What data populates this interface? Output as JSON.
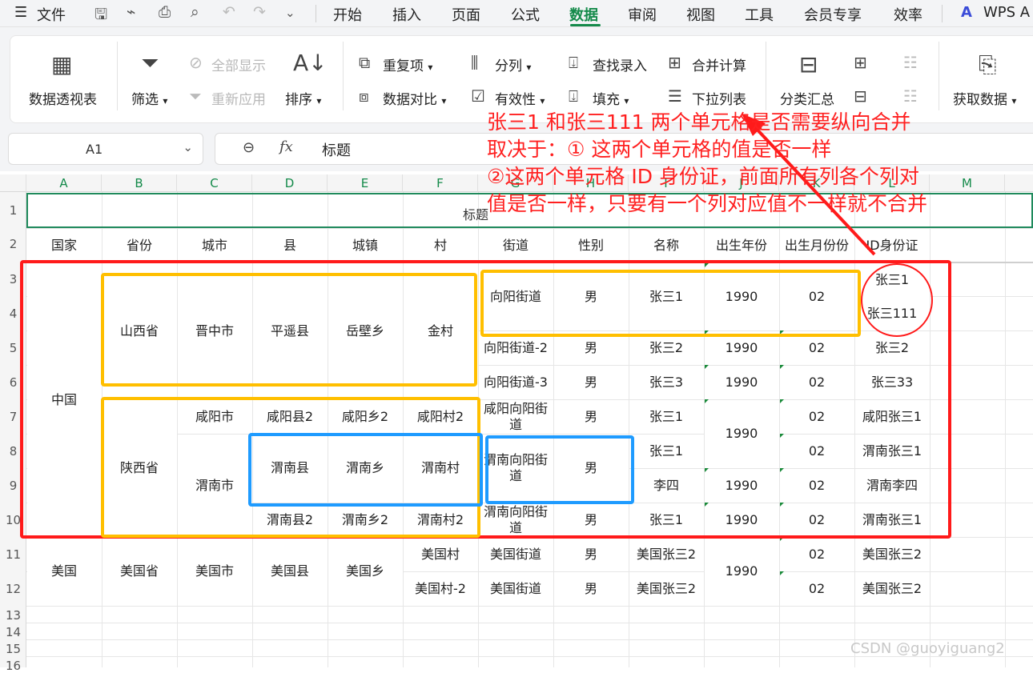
{
  "menubar": {
    "items": [
      "文件",
      "开始",
      "插入",
      "页面",
      "公式",
      "数据",
      "审阅",
      "视图",
      "工具",
      "会员专享",
      "效率"
    ],
    "active": "数据",
    "brand": "WPS A",
    "menu_icon": "hamburger-icon"
  },
  "ribbon": {
    "pivot": "数据透视表",
    "filter": "筛选",
    "show_all": "全部显示",
    "reapply": "重新应用",
    "sort": "排序",
    "duplicates": "重复项",
    "compare": "数据对比",
    "split": "分列",
    "validity": "有效性",
    "lookup_entry": "查找录入",
    "fill": "填充",
    "consolidate": "合并计算",
    "dropdown_list": "下拉列表",
    "subtotal": "分类汇总",
    "get_data": "获取数据"
  },
  "formula_bar": {
    "cell_ref": "A1",
    "fx": "fx",
    "value": "标题"
  },
  "columns": [
    "A",
    "B",
    "C",
    "D",
    "E",
    "F",
    "G",
    "H",
    "I",
    "J",
    "K",
    "L",
    "M"
  ],
  "rows": [
    "1",
    "2",
    "3",
    "4",
    "5",
    "6",
    "7",
    "8",
    "9",
    "10",
    "11",
    "12",
    "13",
    "14",
    "15",
    "16"
  ],
  "sheet": {
    "title": "标题",
    "headers": [
      "国家",
      "省份",
      "城市",
      "县",
      "城镇",
      "村",
      "街道",
      "性别",
      "名称",
      "出生年份",
      "出生月份份",
      "ID身份证"
    ],
    "country_cn": "中国",
    "country_us": "美国",
    "prov_shanxi": "山西省",
    "prov_shaanxi": "陕西省",
    "prov_us": "美国省",
    "city_jinzhong": "晋中市",
    "city_xianyang": "咸阳市",
    "city_weinan": "渭南市",
    "city_us": "美国市",
    "county_pingyao": "平遥县",
    "county_xianyang2": "咸阳县2",
    "county_weinan": "渭南县",
    "county_weinan2": "渭南县2",
    "county_us": "美国县",
    "town_yuebi": "岳壁乡",
    "town_xianyang2": "咸阳乡2",
    "town_weinan": "渭南乡",
    "town_weinan2": "渭南乡2",
    "town_us": "美国乡",
    "village_jin": "金村",
    "village_xianyang2": "咸阳村2",
    "village_weinan": "渭南村",
    "village_weinan2": "渭南村2",
    "village_us": "美国村",
    "village_us2": "美国村-2",
    "street_xy": "向阳街道",
    "street_xy2": "向阳街道-2",
    "street_xy3": "向阳街道-3",
    "street_xyxy": "咸阳向阳街道",
    "street_wnxy": "渭南向阳街道",
    "street_wnxy2": "渭南向阳街道",
    "street_us": "美国街道",
    "street_us2": "美国街道",
    "male": "男",
    "name_zs1": "张三1",
    "name_zs2": "张三2",
    "name_zs3": "张三3",
    "name_lisi": "李四",
    "name_us": "美国张三2",
    "year": "1990",
    "month": "02",
    "id_zs1": "张三1",
    "id_zs111": "张三111",
    "id_zs2": "张三2",
    "id_zs33": "张三33",
    "id_xyzs1": "咸阳张三1",
    "id_wnzs1": "渭南张三1",
    "id_wnls": "渭南李四",
    "id_us": "美国张三2"
  },
  "annotation": {
    "line1": "张三1 和张三111 两个单元格是否需要纵向合并",
    "line2": "取决于：① 这两个单元格的值是否一样",
    "line3": "②这两个单元格 ID 身份证，前面所有列各个列对",
    "line4": "值是否一样，只要有一个列对应值不一样就不合并"
  },
  "watermark": "CSDN @guoyiguang2",
  "colors": {
    "accent": "#148a4a",
    "red_box": "#ff1a1a",
    "yellow_box": "#ffbf00",
    "blue_box": "#1e9bff",
    "annotation_text": "#ff2020"
  }
}
